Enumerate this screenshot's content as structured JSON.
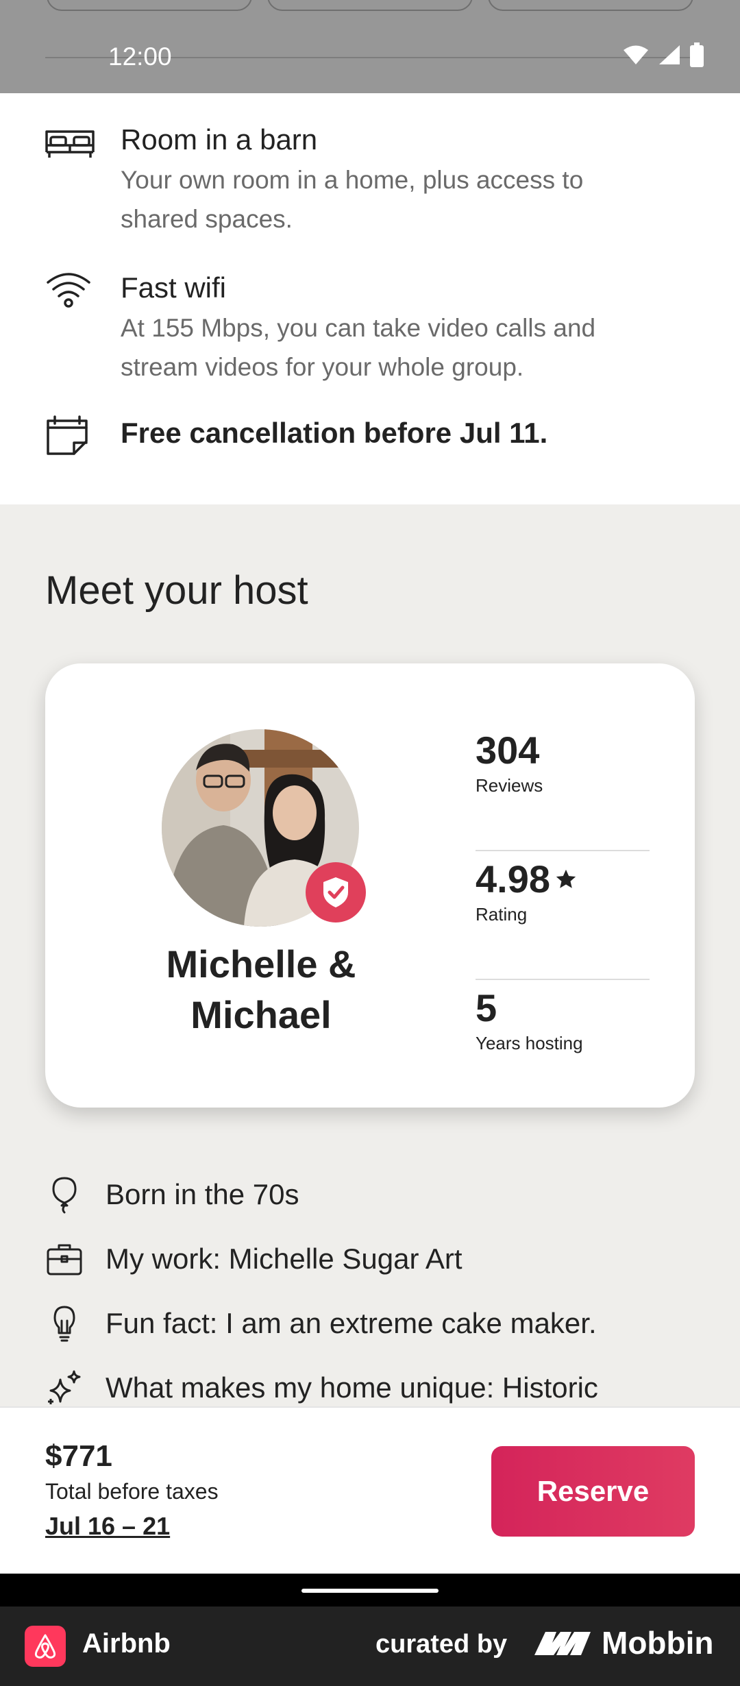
{
  "status": {
    "time": "12:00"
  },
  "features": [
    {
      "icon": "room-icon",
      "title": "Room in a barn",
      "subtitle": [
        "Your own room in a home, plus access to",
        "shared spaces."
      ]
    },
    {
      "icon": "wifi-icon",
      "title": "Fast wifi",
      "subtitle": [
        "At 155 Mbps, you can take video calls and",
        "stream videos for your whole group."
      ]
    },
    {
      "icon": "calendar-icon",
      "title": "Free cancellation before Jul 11.",
      "subtitle": []
    }
  ],
  "host": {
    "heading": "Meet your host",
    "name_line1": "Michelle &",
    "name_line2": "Michael",
    "stats": [
      {
        "value": "304",
        "label": "Reviews"
      },
      {
        "value": "4.98",
        "label": "Rating",
        "star": true
      },
      {
        "value": "5",
        "label": "Years hosting"
      }
    ],
    "facts": [
      {
        "icon": "balloon-icon",
        "text": "Born in the 70s"
      },
      {
        "icon": "briefcase-icon",
        "text": "My work: Michelle Sugar Art"
      },
      {
        "icon": "lightbulb-icon",
        "text": "Fun fact: I am an extreme cake maker."
      },
      {
        "icon": "sparkles-icon",
        "text": "What makes my home unique: Historic"
      }
    ]
  },
  "booking": {
    "price": "$771",
    "price_note": "Total before taxes",
    "dates": "Jul 16 – 21",
    "reserve_label": "Reserve",
    "accent": "#D82A5E"
  },
  "footer": {
    "app_name": "Airbnb",
    "curated_by": "curated by",
    "brand": "Mobbin"
  }
}
